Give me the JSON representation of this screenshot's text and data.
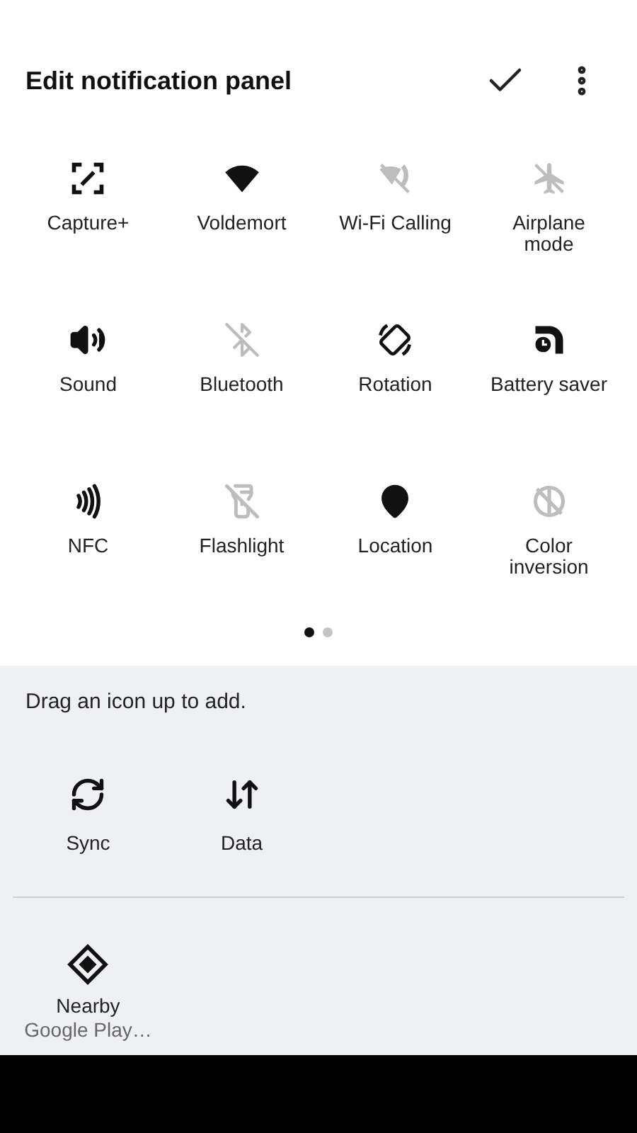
{
  "header": {
    "title": "Edit notification panel"
  },
  "active_tiles": [
    {
      "kind": "capture",
      "label": "Capture+",
      "on": true
    },
    {
      "kind": "wifi",
      "label": "Voldemort",
      "on": true
    },
    {
      "kind": "wifi-calling",
      "label": "Wi-Fi Calling",
      "on": false
    },
    {
      "kind": "airplane",
      "label": "Airplane mode",
      "on": false
    },
    {
      "kind": "sound",
      "label": "Sound",
      "on": true
    },
    {
      "kind": "bluetooth",
      "label": "Bluetooth",
      "on": false
    },
    {
      "kind": "rotation",
      "label": "Rotation",
      "on": true
    },
    {
      "kind": "battery-saver",
      "label": "Battery saver",
      "on": true
    },
    {
      "kind": "nfc",
      "label": "NFC",
      "on": true
    },
    {
      "kind": "flashlight",
      "label": "Flashlight",
      "on": false
    },
    {
      "kind": "location",
      "label": "Location",
      "on": true
    },
    {
      "kind": "color-inversion",
      "label": "Color inversion",
      "on": false
    }
  ],
  "pages": [
    {
      "selected": true
    },
    {
      "selected": false
    }
  ],
  "hint": "Drag an icon up to add.",
  "available_tiles": [
    {
      "kind": "sync",
      "label": "Sync"
    },
    {
      "kind": "data",
      "label": "Data"
    }
  ],
  "third_party_tiles": [
    {
      "kind": "nearby",
      "label": "Nearby",
      "source": "Google Play…"
    }
  ]
}
